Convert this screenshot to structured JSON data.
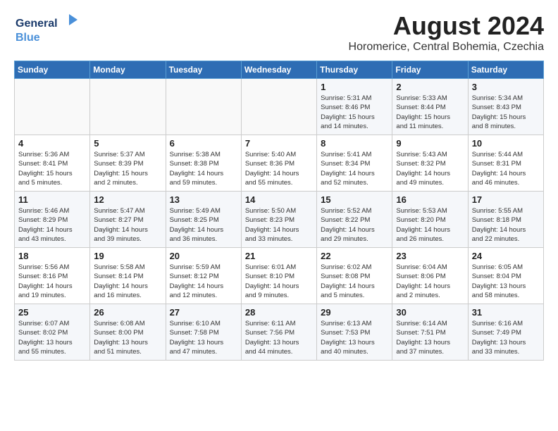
{
  "logo": {
    "line1": "General",
    "line2": "Blue"
  },
  "title": "August 2024",
  "location": "Horomerice, Central Bohemia, Czechia",
  "days_of_week": [
    "Sunday",
    "Monday",
    "Tuesday",
    "Wednesday",
    "Thursday",
    "Friday",
    "Saturday"
  ],
  "weeks": [
    [
      {
        "day": "",
        "info": ""
      },
      {
        "day": "",
        "info": ""
      },
      {
        "day": "",
        "info": ""
      },
      {
        "day": "",
        "info": ""
      },
      {
        "day": "1",
        "info": "Sunrise: 5:31 AM\nSunset: 8:46 PM\nDaylight: 15 hours\nand 14 minutes."
      },
      {
        "day": "2",
        "info": "Sunrise: 5:33 AM\nSunset: 8:44 PM\nDaylight: 15 hours\nand 11 minutes."
      },
      {
        "day": "3",
        "info": "Sunrise: 5:34 AM\nSunset: 8:43 PM\nDaylight: 15 hours\nand 8 minutes."
      }
    ],
    [
      {
        "day": "4",
        "info": "Sunrise: 5:36 AM\nSunset: 8:41 PM\nDaylight: 15 hours\nand 5 minutes."
      },
      {
        "day": "5",
        "info": "Sunrise: 5:37 AM\nSunset: 8:39 PM\nDaylight: 15 hours\nand 2 minutes."
      },
      {
        "day": "6",
        "info": "Sunrise: 5:38 AM\nSunset: 8:38 PM\nDaylight: 14 hours\nand 59 minutes."
      },
      {
        "day": "7",
        "info": "Sunrise: 5:40 AM\nSunset: 8:36 PM\nDaylight: 14 hours\nand 55 minutes."
      },
      {
        "day": "8",
        "info": "Sunrise: 5:41 AM\nSunset: 8:34 PM\nDaylight: 14 hours\nand 52 minutes."
      },
      {
        "day": "9",
        "info": "Sunrise: 5:43 AM\nSunset: 8:32 PM\nDaylight: 14 hours\nand 49 minutes."
      },
      {
        "day": "10",
        "info": "Sunrise: 5:44 AM\nSunset: 8:31 PM\nDaylight: 14 hours\nand 46 minutes."
      }
    ],
    [
      {
        "day": "11",
        "info": "Sunrise: 5:46 AM\nSunset: 8:29 PM\nDaylight: 14 hours\nand 43 minutes."
      },
      {
        "day": "12",
        "info": "Sunrise: 5:47 AM\nSunset: 8:27 PM\nDaylight: 14 hours\nand 39 minutes."
      },
      {
        "day": "13",
        "info": "Sunrise: 5:49 AM\nSunset: 8:25 PM\nDaylight: 14 hours\nand 36 minutes."
      },
      {
        "day": "14",
        "info": "Sunrise: 5:50 AM\nSunset: 8:23 PM\nDaylight: 14 hours\nand 33 minutes."
      },
      {
        "day": "15",
        "info": "Sunrise: 5:52 AM\nSunset: 8:22 PM\nDaylight: 14 hours\nand 29 minutes."
      },
      {
        "day": "16",
        "info": "Sunrise: 5:53 AM\nSunset: 8:20 PM\nDaylight: 14 hours\nand 26 minutes."
      },
      {
        "day": "17",
        "info": "Sunrise: 5:55 AM\nSunset: 8:18 PM\nDaylight: 14 hours\nand 22 minutes."
      }
    ],
    [
      {
        "day": "18",
        "info": "Sunrise: 5:56 AM\nSunset: 8:16 PM\nDaylight: 14 hours\nand 19 minutes."
      },
      {
        "day": "19",
        "info": "Sunrise: 5:58 AM\nSunset: 8:14 PM\nDaylight: 14 hours\nand 16 minutes."
      },
      {
        "day": "20",
        "info": "Sunrise: 5:59 AM\nSunset: 8:12 PM\nDaylight: 14 hours\nand 12 minutes."
      },
      {
        "day": "21",
        "info": "Sunrise: 6:01 AM\nSunset: 8:10 PM\nDaylight: 14 hours\nand 9 minutes."
      },
      {
        "day": "22",
        "info": "Sunrise: 6:02 AM\nSunset: 8:08 PM\nDaylight: 14 hours\nand 5 minutes."
      },
      {
        "day": "23",
        "info": "Sunrise: 6:04 AM\nSunset: 8:06 PM\nDaylight: 14 hours\nand 2 minutes."
      },
      {
        "day": "24",
        "info": "Sunrise: 6:05 AM\nSunset: 8:04 PM\nDaylight: 13 hours\nand 58 minutes."
      }
    ],
    [
      {
        "day": "25",
        "info": "Sunrise: 6:07 AM\nSunset: 8:02 PM\nDaylight: 13 hours\nand 55 minutes."
      },
      {
        "day": "26",
        "info": "Sunrise: 6:08 AM\nSunset: 8:00 PM\nDaylight: 13 hours\nand 51 minutes."
      },
      {
        "day": "27",
        "info": "Sunrise: 6:10 AM\nSunset: 7:58 PM\nDaylight: 13 hours\nand 47 minutes."
      },
      {
        "day": "28",
        "info": "Sunrise: 6:11 AM\nSunset: 7:56 PM\nDaylight: 13 hours\nand 44 minutes."
      },
      {
        "day": "29",
        "info": "Sunrise: 6:13 AM\nSunset: 7:53 PM\nDaylight: 13 hours\nand 40 minutes."
      },
      {
        "day": "30",
        "info": "Sunrise: 6:14 AM\nSunset: 7:51 PM\nDaylight: 13 hours\nand 37 minutes."
      },
      {
        "day": "31",
        "info": "Sunrise: 6:16 AM\nSunset: 7:49 PM\nDaylight: 13 hours\nand 33 minutes."
      }
    ]
  ]
}
